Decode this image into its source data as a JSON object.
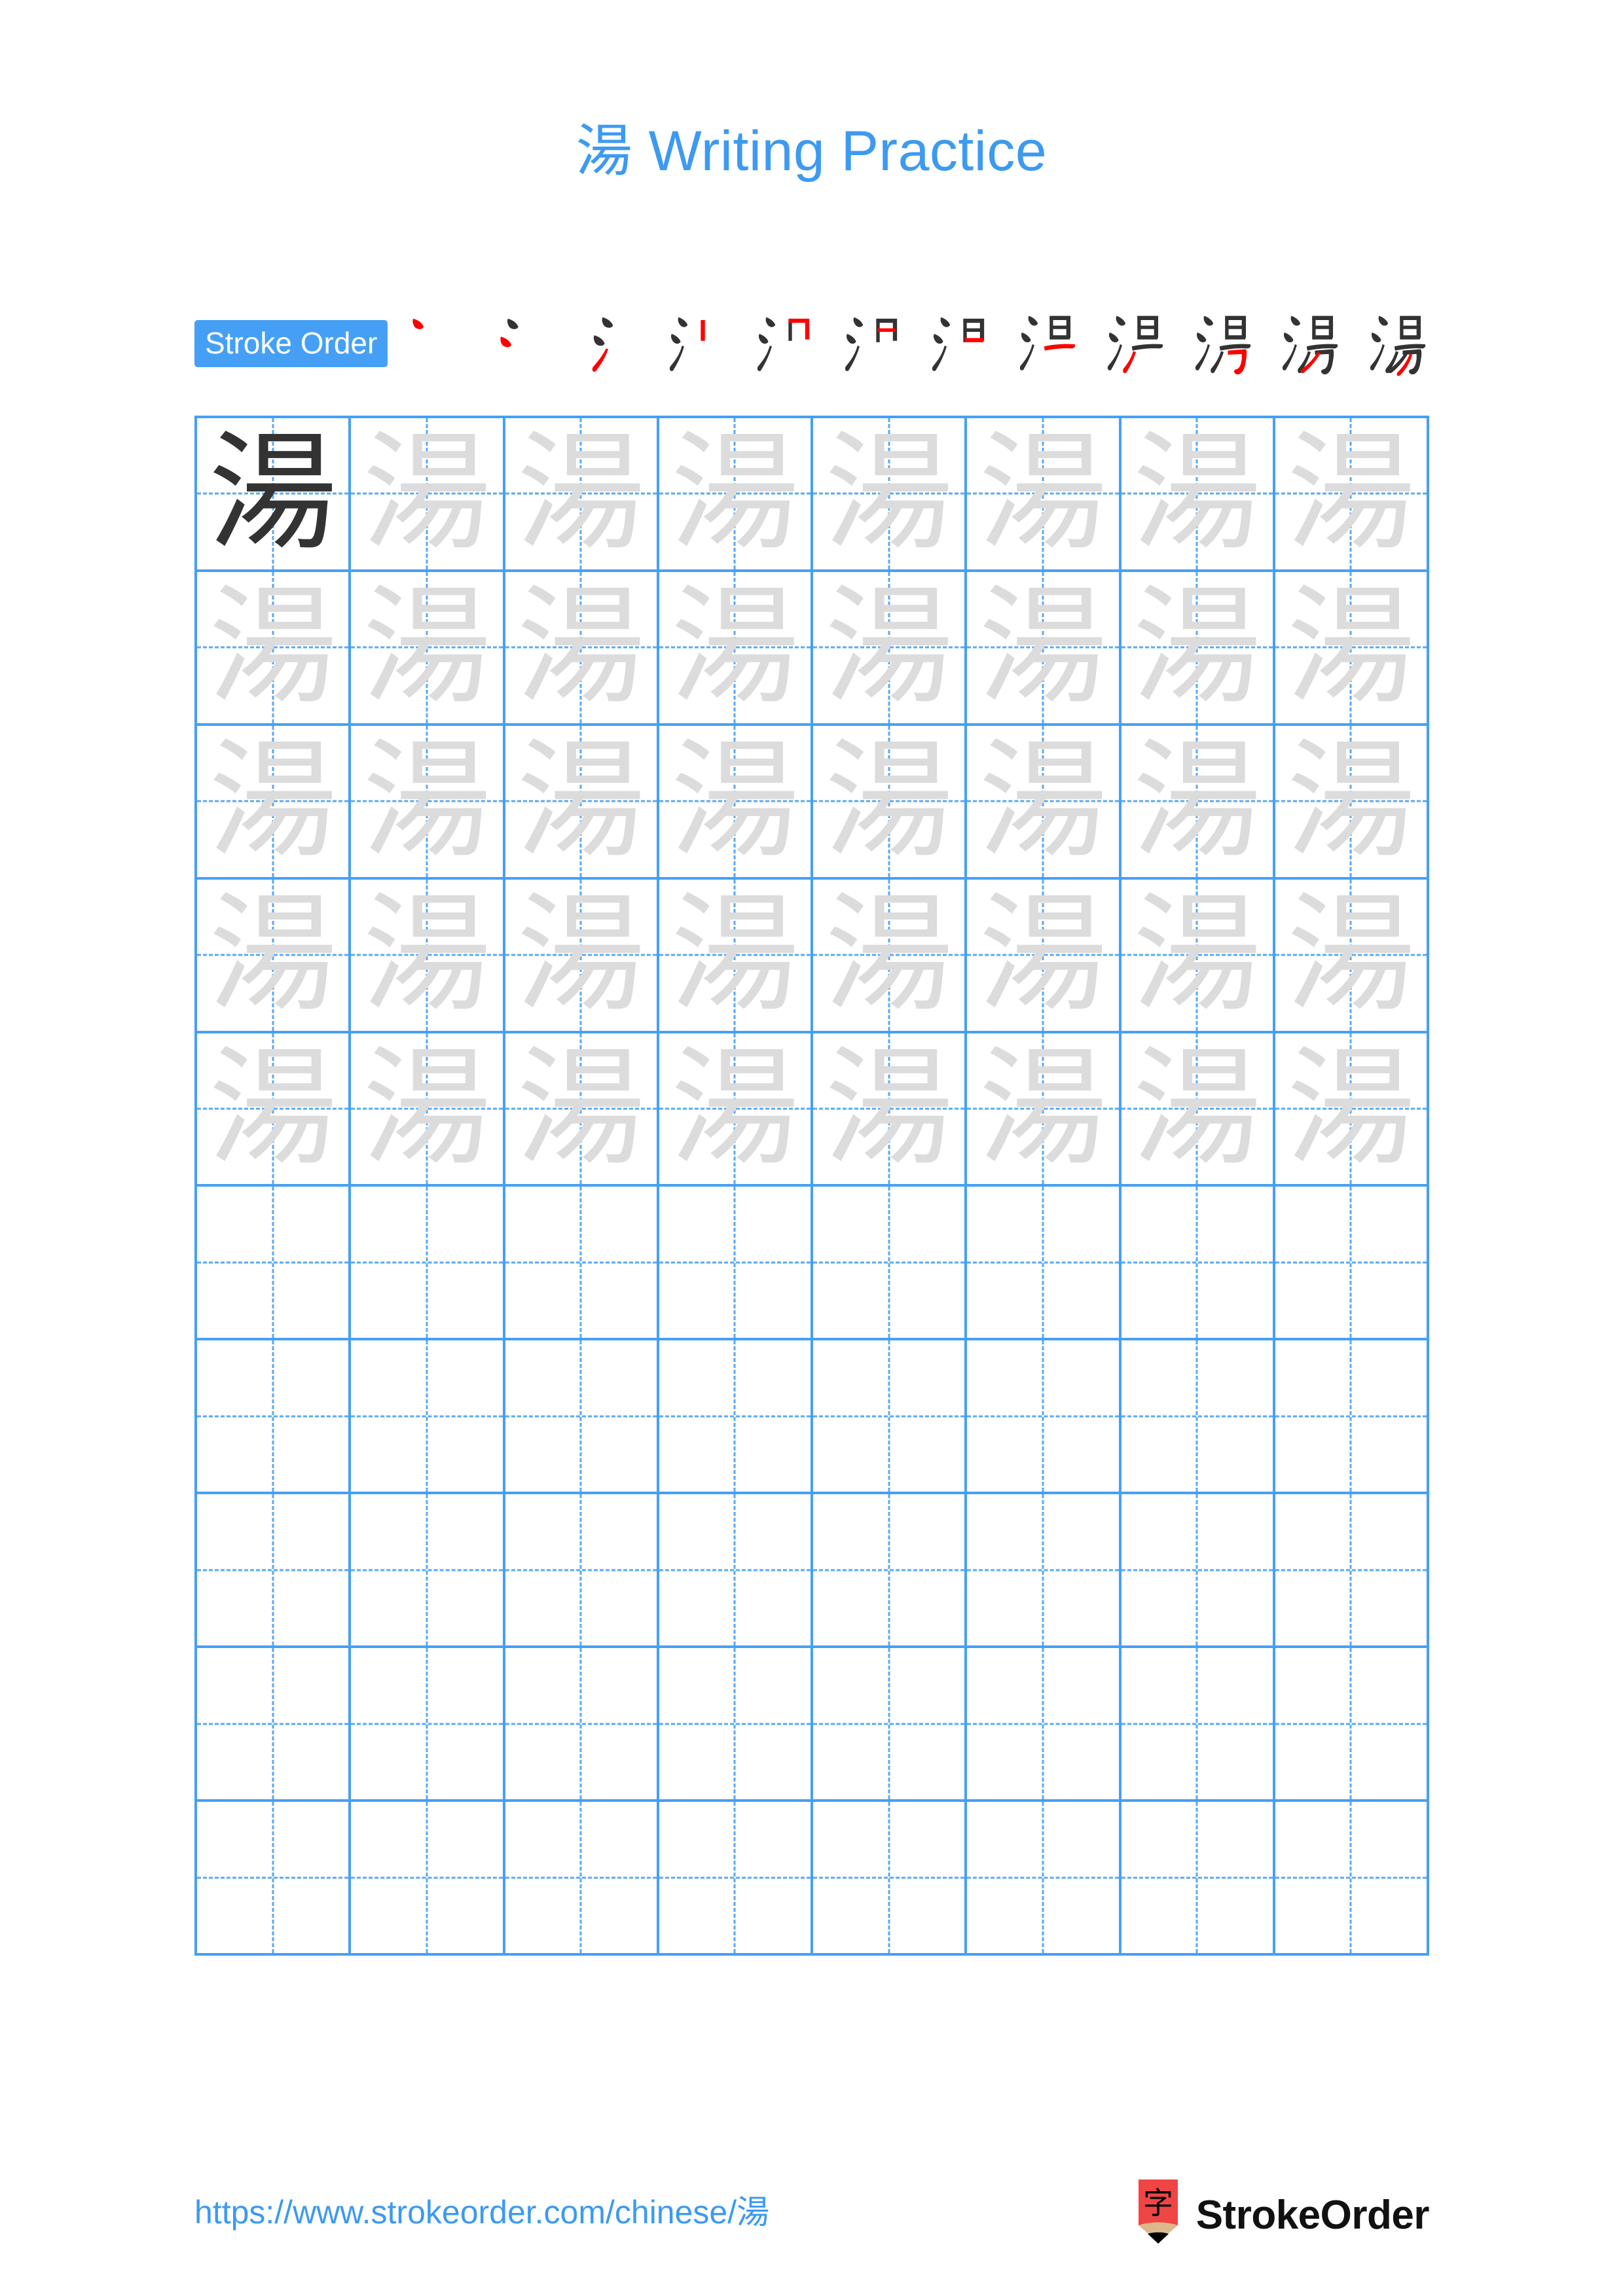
{
  "page": {
    "character": "湯",
    "title": "湯 Writing Practice",
    "background_color": "#ffffff"
  },
  "colors": {
    "accent_blue": "#3d9af0",
    "grid_blue": "#45a0f5",
    "guide_blue": "#5aa9f3",
    "model_glyph": "#333333",
    "trace_glyph": "#dcdcdc",
    "stroke_new": "#ff0000",
    "stroke_done": "#333333",
    "logo_red": "#f04545",
    "logo_wood": "#dcb98c"
  },
  "stroke_order": {
    "label": "Stroke Order",
    "total_strokes": 12,
    "steps": [
      {
        "index": 1,
        "partial": "丶"
      },
      {
        "index": 2,
        "partial": "冫"
      },
      {
        "index": 3,
        "partial": "氵"
      },
      {
        "index": 4,
        "partial": "汩"
      },
      {
        "index": 5,
        "partial": "汩"
      },
      {
        "index": 6,
        "partial": "汨"
      },
      {
        "index": 7,
        "partial": "汨"
      },
      {
        "index": 8,
        "partial": "湁"
      },
      {
        "index": 9,
        "partial": "湈"
      },
      {
        "index": 10,
        "partial": "渇"
      },
      {
        "index": 11,
        "partial": "湯"
      },
      {
        "index": 12,
        "partial": "湯"
      }
    ]
  },
  "grid": {
    "columns": 8,
    "rows": 10,
    "row_types": [
      "model_then_trace",
      "trace",
      "trace",
      "trace",
      "trace",
      "blank",
      "blank",
      "blank",
      "blank",
      "blank"
    ]
  },
  "footer": {
    "url": "https://www.strokeorder.com/chinese/湯",
    "brand_name": "StrokeOrder",
    "logo_character": "字"
  }
}
